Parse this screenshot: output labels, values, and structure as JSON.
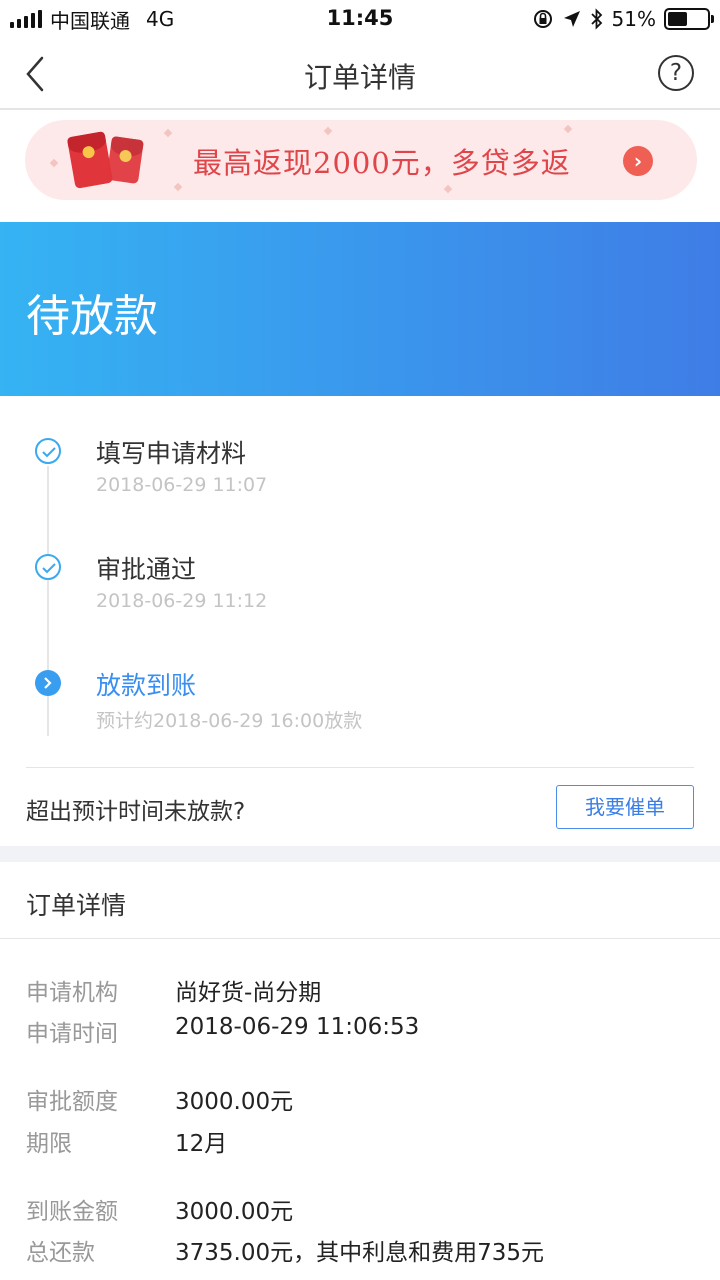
{
  "status_bar": {
    "carrier": "中国联通",
    "network": "4G",
    "time": "11:45",
    "battery": "51%",
    "battery_level": 0.51
  },
  "nav": {
    "title": "订单详情",
    "help": "?"
  },
  "banner": {
    "text": "最高返现2000元，多贷多返"
  },
  "status": {
    "title": "待放款",
    "color_start": "#35b3f3",
    "color_end": "#3f7de6"
  },
  "timeline": {
    "steps": [
      {
        "label": "填写申请材料",
        "time": "2018-06-29 11:07",
        "state": "done"
      },
      {
        "label": "审批通过",
        "time": "2018-06-29 11:12",
        "state": "done"
      },
      {
        "label": "放款到账",
        "time": "预计约2018-06-29 16:00放款",
        "state": "current"
      }
    ]
  },
  "overdue": {
    "question": "超出预计时间未放款?",
    "button": "我要催单"
  },
  "details": {
    "title": "订单详情",
    "rows": [
      {
        "label": "申请机构",
        "value": "尚好货-尚分期"
      },
      {
        "label": "申请时间",
        "value": "2018-06-29 11:06:53"
      },
      {
        "label": "审批额度",
        "value": "3000.00元"
      },
      {
        "label": "期限",
        "value": "12月"
      },
      {
        "label": "到账金额",
        "value": "3000.00元"
      },
      {
        "label": "总还款",
        "value": "3735.00元，其中利息和费用735元"
      }
    ]
  }
}
